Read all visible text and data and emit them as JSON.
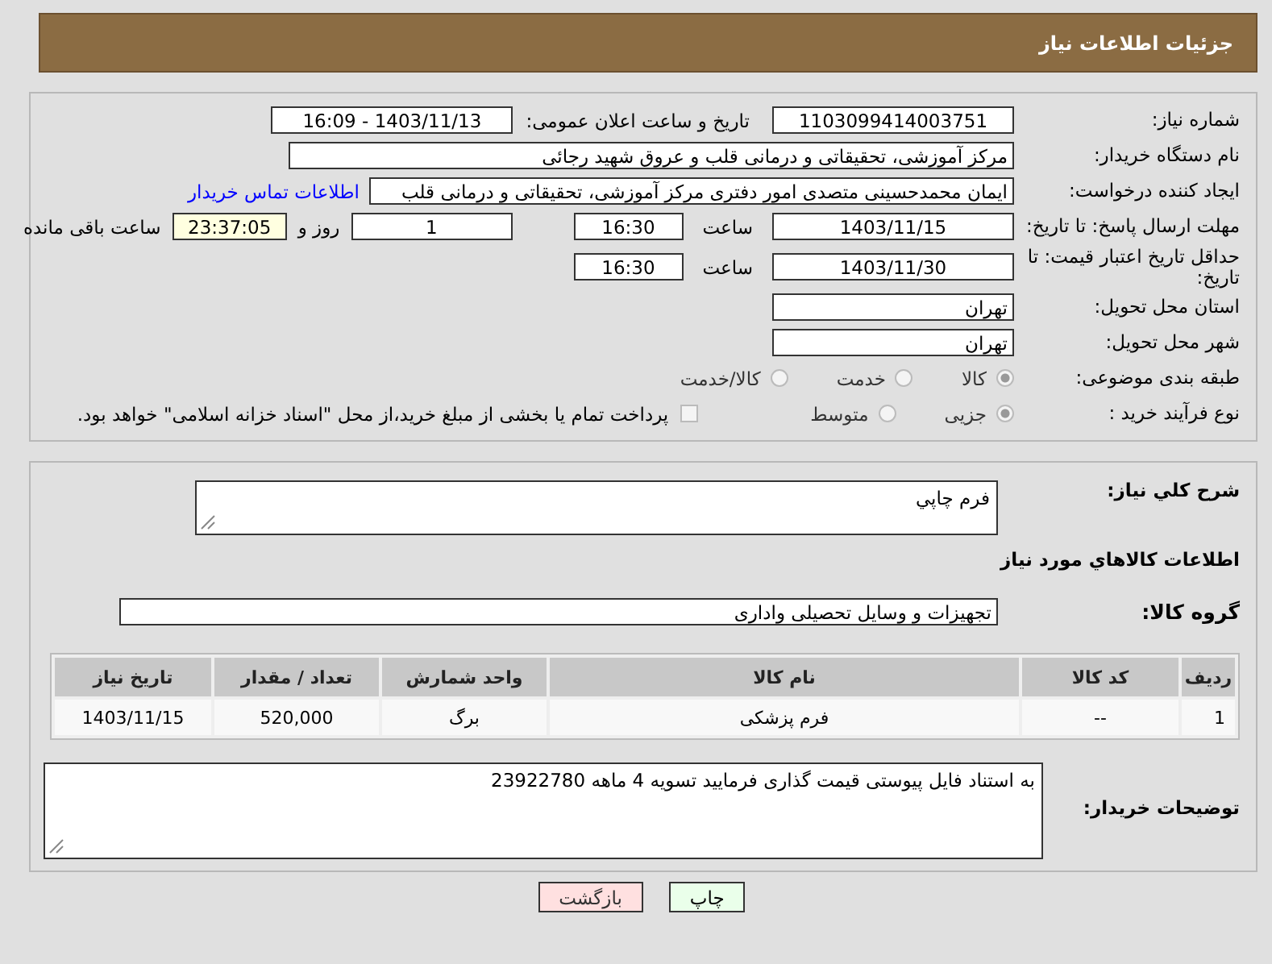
{
  "header": {
    "title": "جزئیات اطلاعات نیاز"
  },
  "need_number": {
    "label": "شماره نیاز:",
    "value": "1103099414003751"
  },
  "announce": {
    "label": "تاریخ و ساعت اعلان عمومی:",
    "value": "1403/11/13 - 16:09"
  },
  "buyer": {
    "label": "نام دستگاه خریدار:",
    "value": "مرکز آموزشی، تحقیقاتی و درمانی قلب و عروق شهید رجائی"
  },
  "creator": {
    "label": "ایجاد کننده درخواست:",
    "value": "ایمان محمدحسینی متصدی امور دفتری مرکز آموزشی، تحقیقاتی و درمانی قلب",
    "link": "اطلاعات تماس خریدار"
  },
  "deadline": {
    "label": "مهلت ارسال پاسخ: تا تاریخ:",
    "date": "1403/11/15",
    "time_label": "ساعت",
    "time": "16:30",
    "days": "1",
    "days_label": "روز و",
    "remaining": "23:37:05",
    "remaining_label": "ساعت باقی مانده"
  },
  "validity": {
    "label": "حداقل تاریخ اعتبار قیمت: تا تاریخ:",
    "date": "1403/11/30",
    "time_label": "ساعت",
    "time": "16:30"
  },
  "province": {
    "label": "استان محل تحویل:",
    "value": "تهران"
  },
  "city": {
    "label": "شهر محل تحویل:",
    "value": "تهران"
  },
  "category": {
    "label": "طبقه بندی موضوعی:",
    "options": [
      {
        "label": "کالا",
        "selected": true
      },
      {
        "label": "خدمت",
        "selected": false
      },
      {
        "label": "کالا/خدمت",
        "selected": false
      }
    ]
  },
  "process": {
    "label": "نوع فرآیند خرید :",
    "options": [
      {
        "label": "جزیی",
        "selected": true
      },
      {
        "label": "متوسط",
        "selected": false
      }
    ],
    "treasury": {
      "checked": false,
      "text": "پرداخت تمام یا بخشی از مبلغ خرید،از محل \"اسناد خزانه اسلامی\" خواهد بود."
    }
  },
  "description": {
    "label": "شرح کلي نياز:",
    "value": "فرم چاپي"
  },
  "goods_heading": "اطلاعات كالاهاي مورد نياز",
  "group": {
    "label": "گروه کالا:",
    "value": "تجهیزات و وسایل تحصیلی واداری"
  },
  "table": {
    "columns": [
      "ردیف",
      "کد کالا",
      "نام کالا",
      "واحد شمارش",
      "تعداد / مقدار",
      "تاریخ نیاز"
    ],
    "rows": [
      [
        "1",
        "--",
        "فرم پزشکی",
        "برگ",
        "520,000",
        "1403/11/15"
      ]
    ]
  },
  "buyer_notes": {
    "label": "توضیحات خریدار:",
    "value": "به استناد فایل پیوستی قیمت گذاری فرمایید تسویه 4 ماهه 23922780"
  },
  "buttons": [
    {
      "label": "چاپ",
      "kind": "print"
    },
    {
      "label": "بازگشت",
      "kind": "back"
    }
  ]
}
